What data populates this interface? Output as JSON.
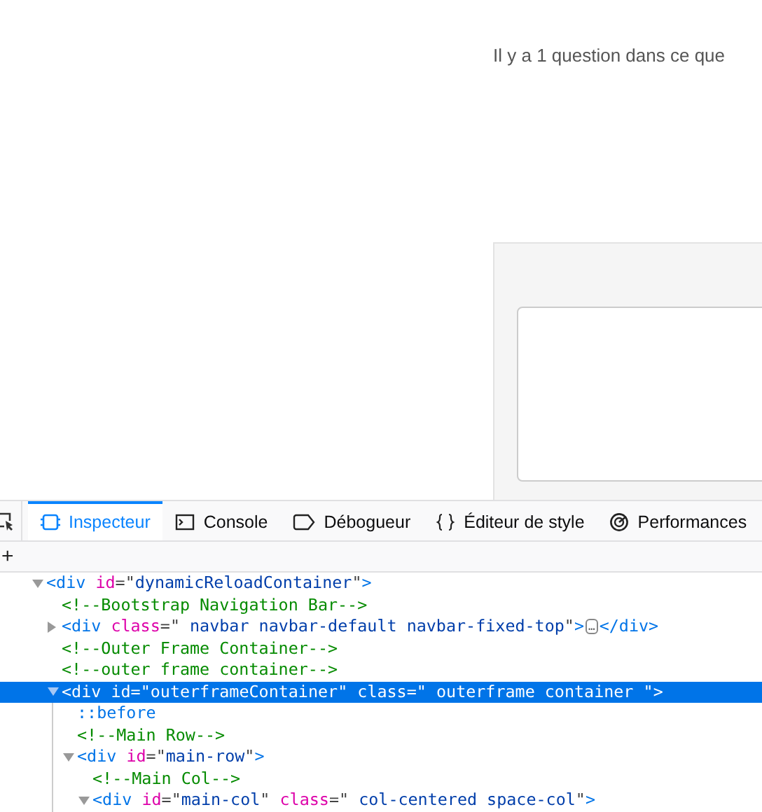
{
  "page": {
    "intro_text": "Il y a 1 question dans ce que"
  },
  "devtools": {
    "tabs": [
      {
        "label": "Inspecteur",
        "selected": true
      },
      {
        "label": "Console",
        "selected": false
      },
      {
        "label": "Débogueur",
        "selected": false
      },
      {
        "label": "Éditeur de style",
        "selected": false
      },
      {
        "label": "Performances",
        "selected": false
      }
    ],
    "add_button": "+",
    "tree": [
      {
        "kind": "tag",
        "open_tag": "<div id=\"dynamicReloadContainer\">",
        "expanded": true,
        "selected": false,
        "children": [
          {
            "kind": "comment",
            "text": "<!--Bootstrap Navigation Bar-->"
          },
          {
            "kind": "tag",
            "open_tag": "<div class=\" navbar navbar-default navbar-fixed-top\">",
            "expanded": false,
            "selected": false,
            "collapsed_marker": "…",
            "closing_tag": "</div>"
          },
          {
            "kind": "comment",
            "text": "<!--Outer Frame Container-->"
          },
          {
            "kind": "comment",
            "text": "<!--outer frame container-->"
          },
          {
            "kind": "tag",
            "open_tag": "<div id=\"outerframeContainer\" class=\" outerframe container \">",
            "expanded": true,
            "selected": true,
            "children": [
              {
                "kind": "pseudo",
                "text": "::before"
              },
              {
                "kind": "comment",
                "text": "<!--Main Row-->"
              },
              {
                "kind": "tag",
                "open_tag": "<div id=\"main-row\">",
                "expanded": true,
                "selected": false,
                "children": [
                  {
                    "kind": "comment",
                    "text": "<!--Main Col-->"
                  },
                  {
                    "kind": "tag",
                    "open_tag": "<div id=\"main-col\" class=\" col-centered space-col\">",
                    "expanded": true,
                    "selected": false
                  }
                ]
              }
            ]
          }
        ]
      }
    ]
  }
}
